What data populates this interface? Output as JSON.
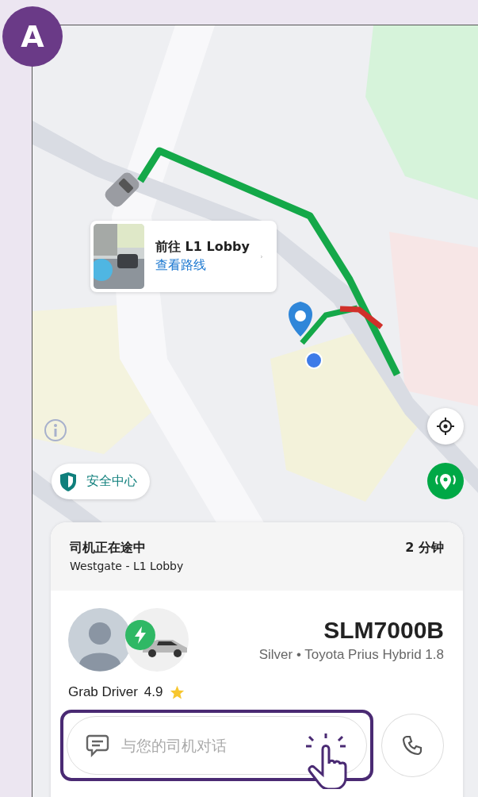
{
  "badge": {
    "label": "A"
  },
  "destination_card": {
    "title": "前往 L1 Lobby",
    "link": "查看路线"
  },
  "safety_button": {
    "label": "安全中心"
  },
  "trip": {
    "status": "司机正在途中",
    "route": "Westgate - L1 Lobby",
    "eta": "2 分钟"
  },
  "driver": {
    "plate": "SLM7000B",
    "vehicle": "Silver • Toyota Prius Hybrid 1.8",
    "name": "Grab Driver",
    "rating": "4.9"
  },
  "chat": {
    "placeholder": "与您的司机对话",
    "highlighted": true
  }
}
